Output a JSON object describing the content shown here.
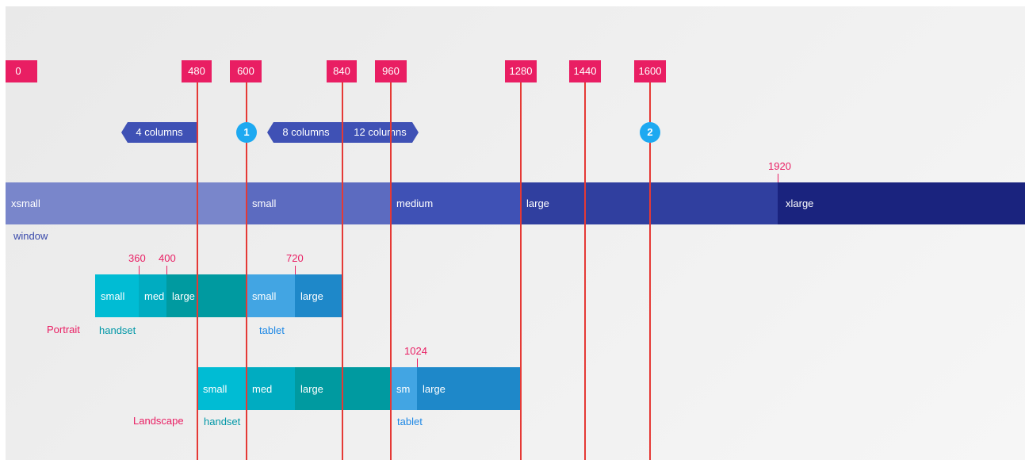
{
  "breakpoints": [
    "0",
    "480",
    "600",
    "840",
    "960",
    "1280",
    "1440",
    "1600"
  ],
  "column_tags": [
    "4 columns",
    "8 columns",
    "12 columns"
  ],
  "markers": [
    "1",
    "2"
  ],
  "window": {
    "caption": "window",
    "segments": [
      "xsmall",
      "small",
      "medium",
      "large",
      "xlarge"
    ],
    "label_1920": "1920"
  },
  "portrait": {
    "row_label": "Portrait",
    "handset_caption": "handset",
    "tablet_caption": "tablet",
    "segments": [
      "small",
      "med",
      "large",
      "small",
      "large"
    ],
    "ticks": [
      "360",
      "400",
      "720"
    ]
  },
  "landscape": {
    "row_label": "Landscape",
    "handset_caption": "handset",
    "tablet_caption": "tablet",
    "segments": [
      "small",
      "med",
      "large",
      "sm",
      "large"
    ],
    "ticks": [
      "1024"
    ]
  },
  "colors": {
    "breakpoint": "#e91e63",
    "gridline": "#e53935",
    "column_tag": "#3f51b5",
    "marker": "#1da9f1",
    "xsmall": "#7986cb",
    "small": "#5c6bc0",
    "medium": "#3f51b5",
    "large": "#303f9f",
    "xlarge": "#1a237e",
    "handset_small": "#00bcd4",
    "handset_med": "#00acc1",
    "handset_large": "#009aa0",
    "tablet_small": "#42a5e3",
    "tablet_large": "#1e88c9",
    "handset_text": "#0097a7",
    "tablet_text": "#1e88e5",
    "window_text": "#3949ab"
  }
}
